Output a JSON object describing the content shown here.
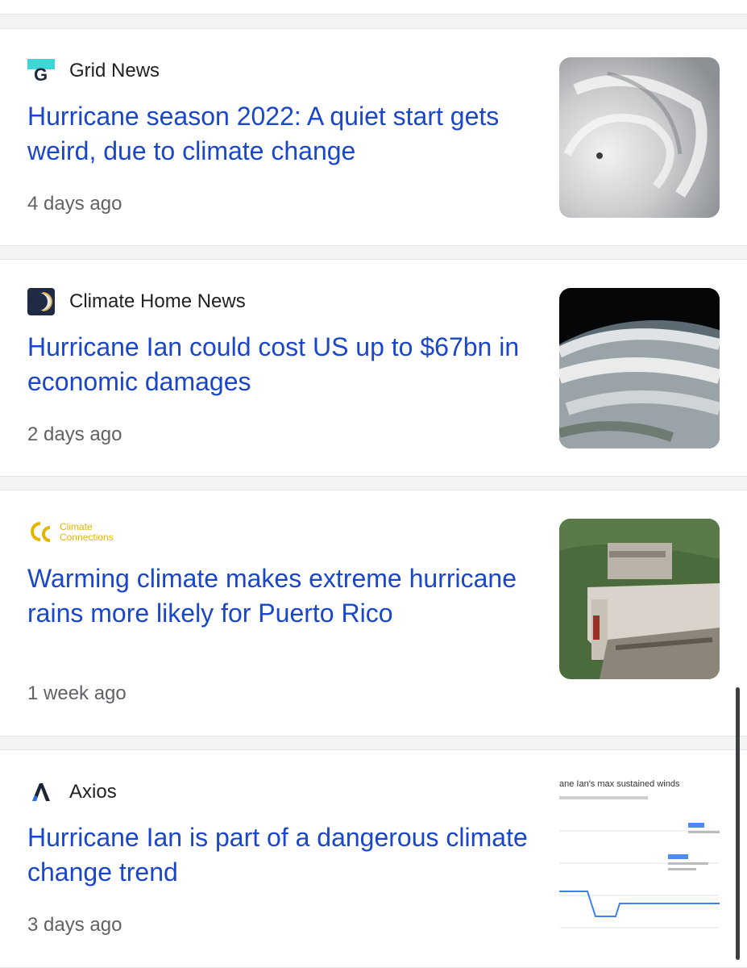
{
  "articles": [
    {
      "source": "Grid News",
      "logo_icon": "grid-news-logo",
      "headline": "Hurricane season 2022: A quiet start gets weird, due to climate change",
      "time": "4 days ago",
      "thumbnail": "hurricane-eye-satellite"
    },
    {
      "source": "Climate Home News",
      "logo_icon": "climate-home-news-logo",
      "headline": "Hurricane Ian could cost US up to $67bn in economic damages",
      "time": "2 days ago",
      "thumbnail": "earth-orbit-storm"
    },
    {
      "source": "Climate Connections",
      "logo_icon": "climate-connections-logo",
      "logo_text_line1": "Climate",
      "logo_text_line2": "Connections",
      "headline": "Warming climate makes extreme hurricane rains more likely for Puerto Rico",
      "time": "1 week ago",
      "thumbnail": "collapsed-house"
    },
    {
      "source": "Axios",
      "logo_icon": "axios-logo",
      "headline": "Hurricane Ian is part of a dangerous climate change trend",
      "time": "3 days ago",
      "thumbnail": "wind-speed-chart",
      "thumbnail_title": "ane Ian's max sustained winds"
    }
  ],
  "colors": {
    "headline": "#1a47c9",
    "source": "#202124",
    "timestamp": "#5f6368",
    "background": "#f1f3f4"
  }
}
